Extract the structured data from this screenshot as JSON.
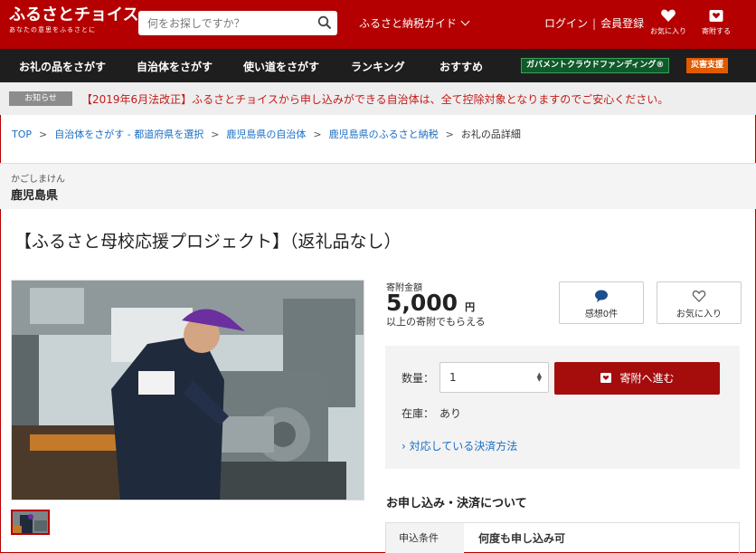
{
  "header": {
    "logo_main": "ふるさとチョイス",
    "logo_sub": "あなたの意思をふるさとに",
    "search_placeholder": "何をお探しですか？",
    "guide_label": "ふるさと納税ガイド",
    "login_label": "ログイン",
    "register_label": "会員登録",
    "favorites_label": "お気に入り",
    "donate_label": "寄附する"
  },
  "nav": {
    "items": [
      "お礼の品をさがす",
      "自治体をさがす",
      "使い道をさがす",
      "ランキング",
      "おすすめ"
    ],
    "government_label": "ガバメントクラウドファンディング®",
    "disaster_label": "災害支援"
  },
  "notice": {
    "tag": "お知らせ",
    "text": "【2019年6月法改正】ふるさとチョイスから申し込みができる自治体は、全て控除対象となりますのでご安心ください。"
  },
  "breadcrumb": {
    "items": [
      "TOP",
      "自治体をさがす - 都道府県を選択",
      "鹿児島県の自治体",
      "鹿児島県のふるさと納税"
    ],
    "current": "お礼の品詳細"
  },
  "prefecture": {
    "kana": "かごしまけん",
    "name": "鹿児島県"
  },
  "product": {
    "title": "【ふるさと母校応援プロジェクト】（返礼品なし）",
    "amount_label": "寄附金額",
    "amount": "5,000",
    "currency": "円",
    "amount_note": "以上の寄附でもらえる",
    "thanks_label": "感想0件",
    "favorite_label": "お気に入り",
    "quantity_label": "数量：",
    "quantity_value": "1",
    "donate_button": "寄附へ進む",
    "stock_label": "在庫：",
    "stock_value": "あり",
    "payment_link": "› 対応している決済方法"
  },
  "apply": {
    "heading": "お申し込み・決済について",
    "condition_key": "申込条件",
    "condition_value": "何度も申し込み可"
  },
  "colors": {
    "brand_red": "#b40000",
    "nav_dark": "#1e1e1e",
    "link_blue": "#1a6fc4"
  }
}
